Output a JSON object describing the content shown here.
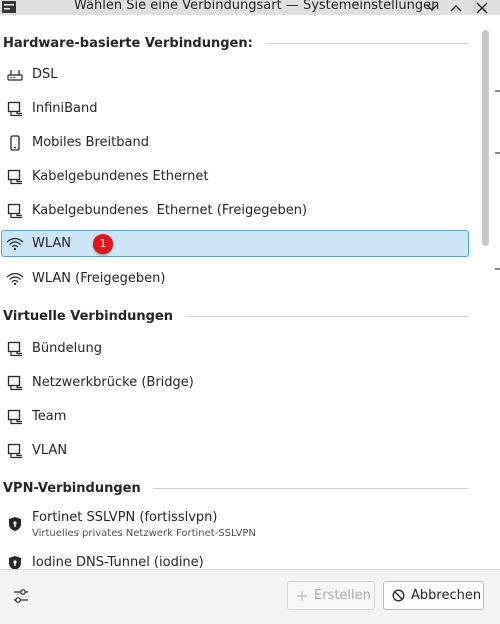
{
  "window": {
    "title": "Wählen Sie eine Verbindungsart — Systemeinstellungen"
  },
  "sections": [
    {
      "label": "Hardware-basierte Verbindungen:",
      "items": [
        {
          "label": "DSL",
          "icon": "modem-icon"
        },
        {
          "label": "InfiniBand",
          "icon": "network-wired-icon"
        },
        {
          "label": "Mobiles Breitband",
          "icon": "smartphone-icon"
        },
        {
          "label": "Kabelgebundenes Ethernet",
          "icon": "network-wired-icon"
        },
        {
          "label": "Kabelgebundenes  Ethernet (Freigegeben)",
          "icon": "network-wired-icon"
        },
        {
          "label": "WLAN",
          "icon": "wifi-icon",
          "selected": true,
          "badge": "1"
        },
        {
          "label": "WLAN (Freigegeben)",
          "icon": "wifi-icon"
        }
      ]
    },
    {
      "label": "Virtuelle Verbindungen",
      "items": [
        {
          "label": "Bündelung",
          "icon": "network-wired-icon"
        },
        {
          "label": "Netzwerkbrücke (Bridge)",
          "icon": "network-wired-icon"
        },
        {
          "label": "Team",
          "icon": "network-wired-icon"
        },
        {
          "label": "VLAN",
          "icon": "network-wired-icon"
        }
      ]
    },
    {
      "label": "VPN-Verbindungen",
      "items": [
        {
          "label": "Fortinet SSLVPN (fortisslvpn)",
          "sublabel": "Virtuelles privates Netzwerk Fortinet-SSLVPN",
          "icon": "shield-icon"
        },
        {
          "label": "Iodine DNS-Tunnel (iodine)",
          "icon": "shield-icon"
        }
      ]
    }
  ],
  "footer": {
    "create_label": "Erstellen",
    "cancel_label": "Abbrechen"
  },
  "colors": {
    "selection_bg": "#cde6f7",
    "selection_border": "#3daee9",
    "badge": "#e1141a"
  }
}
